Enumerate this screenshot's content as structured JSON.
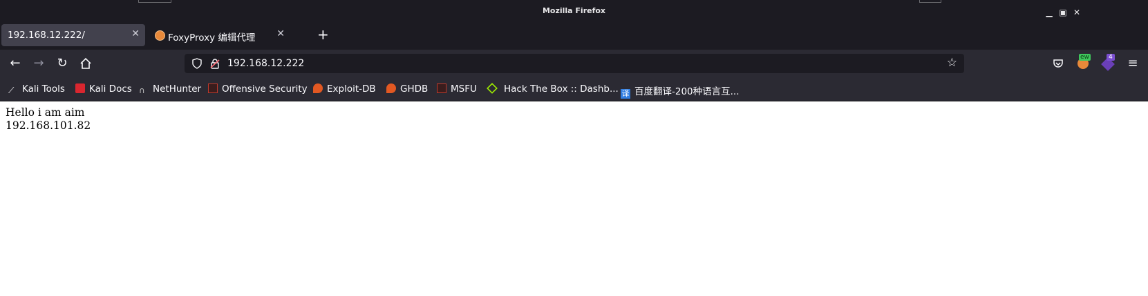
{
  "window": {
    "title": "Mozilla Firefox"
  },
  "tabs": [
    {
      "label": "192.168.12.222/",
      "active": true
    },
    {
      "label": "FoxyProxy 编辑代理",
      "active": false
    }
  ],
  "toolbar": {
    "url": "192.168.12.222",
    "badge_count": "4",
    "new_badge": "ew"
  },
  "bookmarks": [
    {
      "label": "Kali Tools",
      "icon": "kali-dragon-icon"
    },
    {
      "label": "Kali Docs",
      "icon": "kali-docs-icon"
    },
    {
      "label": "NetHunter",
      "icon": "nethunter-icon"
    },
    {
      "label": "Offensive Security",
      "icon": "offsec-icon"
    },
    {
      "label": "Exploit-DB",
      "icon": "exploitdb-icon"
    },
    {
      "label": "GHDB",
      "icon": "ghdb-icon"
    },
    {
      "label": "MSFU",
      "icon": "msfu-icon"
    },
    {
      "label": "Hack The Box :: Dashb...",
      "icon": "htb-cube-icon"
    },
    {
      "label": "百度翻译-200种语言互...",
      "icon": "baidu-translate-icon"
    }
  ],
  "page": {
    "line1": "Hello i am aim",
    "line2": "192.168.101.82"
  },
  "colors": {
    "chrome_dark": "#1c1b22",
    "toolbar": "#2b2a33",
    "active_tab": "#42414d"
  }
}
